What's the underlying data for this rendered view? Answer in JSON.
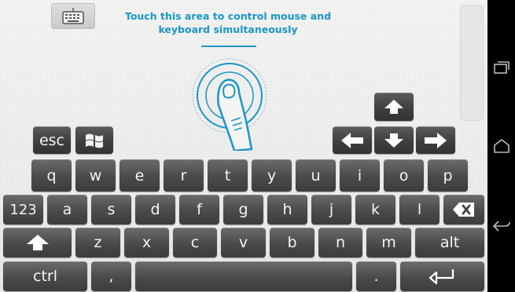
{
  "touchpad": {
    "hint_line1": "Touch this area to control mouse and",
    "hint_line2": "keyboard simultaneously",
    "accent_color": "#1a96c6"
  },
  "keyboard_toggle": {
    "icon": "keyboard-icon"
  },
  "function_keys": {
    "esc": "esc",
    "windows_icon": "windows-logo-icon"
  },
  "arrow_keys": {
    "up_icon": "arrow-up-icon",
    "left_icon": "arrow-left-icon",
    "down_icon": "arrow-down-icon",
    "right_icon": "arrow-right-icon"
  },
  "keyboard": {
    "row1": [
      "q",
      "w",
      "e",
      "r",
      "t",
      "y",
      "u",
      "i",
      "o",
      "p"
    ],
    "row2": [
      "123",
      "a",
      "s",
      "d",
      "f",
      "g",
      "h",
      "j",
      "k",
      "l"
    ],
    "backspace_icon": "backspace-icon",
    "shift_icon": "shift-arrow-icon",
    "row3": [
      "z",
      "x",
      "c",
      "v",
      "b",
      "n",
      "m"
    ],
    "alt": "alt",
    "ctrl": "ctrl",
    "comma": ",",
    "period": ".",
    "space_label": "",
    "enter_icon": "enter-icon"
  },
  "system_nav": {
    "recent_icon": "recent-apps-icon",
    "home_icon": "home-icon",
    "back_icon": "back-icon"
  }
}
